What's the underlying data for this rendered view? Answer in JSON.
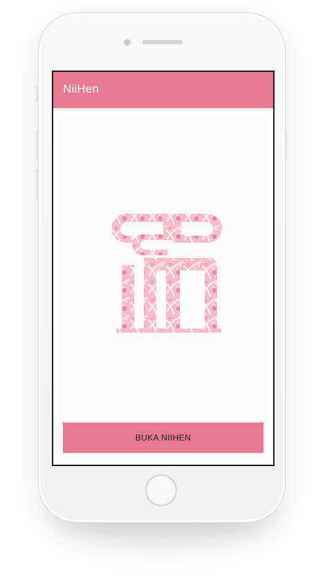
{
  "app": {
    "title": "NiiHen"
  },
  "logo": {
    "icon": "niihen-logo-icon",
    "color": "#f4b6c4"
  },
  "actions": {
    "open_label": "BUKA NIIHEN"
  },
  "theme": {
    "primary": "#e8798f",
    "on_primary": "#ffffff",
    "screen_bg": "#fbfbfb"
  }
}
